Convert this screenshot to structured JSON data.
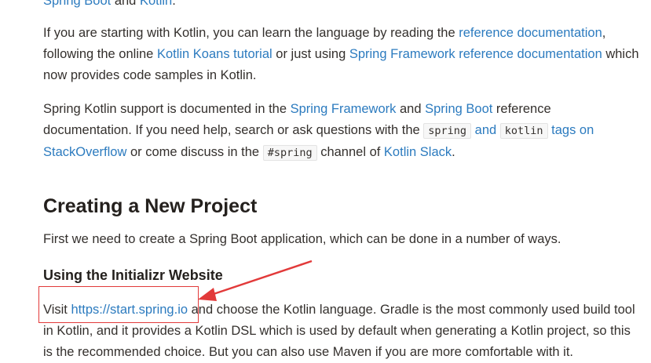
{
  "top_clip": {
    "link1": "Spring Boot",
    "mid": " and ",
    "link2": "Kotlin",
    "end": "."
  },
  "para1": {
    "t1": "If you are starting with Kotlin, you can learn the language by reading the ",
    "link1": "reference documentation",
    "t2": ", following the online ",
    "link2": "Kotlin Koans tutorial",
    "t3": " or just using ",
    "link3": "Spring Framework reference documentation",
    "t4": " which now provides code samples in Kotlin."
  },
  "para2": {
    "t1": "Spring Kotlin support is documented in the ",
    "link1": "Spring Framework",
    "t2": " and ",
    "link2": "Spring Boot",
    "t3": " reference documentation. If you need help, search or ask questions with the ",
    "code1": "spring",
    "link3": " and ",
    "code2": "kotlin",
    "link4": " tags on StackOverflow",
    "t4": " or come discuss in the ",
    "code3": "#spring",
    "t5": " channel of ",
    "link5": "Kotlin Slack",
    "t6": "."
  },
  "heading": "Creating a New Project",
  "para3": "First we need to create a Spring Boot application, which can be done in a number of ways.",
  "subheading": "Using the Initializr Website",
  "para4": {
    "t1": "Visit ",
    "link": "https://start.spring.io",
    "t2": " and choose the Kotlin language. Gradle is the most commonly used build tool in Kotlin, and it provides a Kotlin DSL which is used by default when generating a Kotlin project, so this is the recommended choice. But you can also use Maven if you are more comfortable with it."
  },
  "colors": {
    "link": "#2c7bbf",
    "annotation": "#e23a3a",
    "text": "#34302d"
  }
}
